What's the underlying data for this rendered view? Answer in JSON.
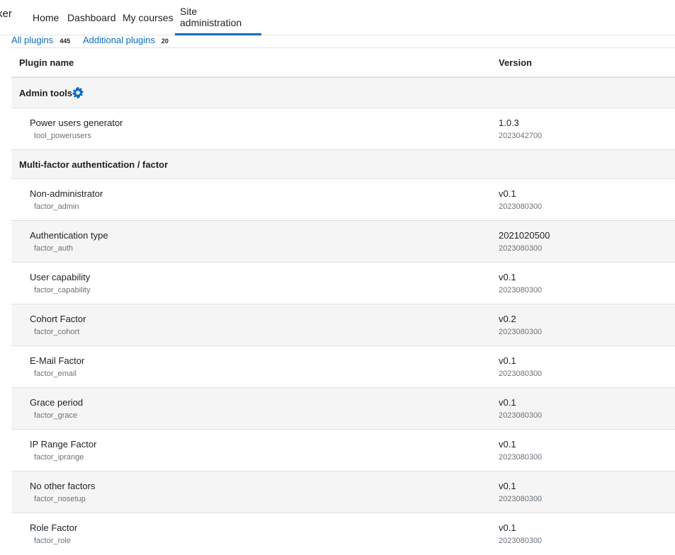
{
  "navbar": {
    "brand": "ker",
    "items": [
      {
        "label": "Home"
      },
      {
        "label": "Dashboard"
      },
      {
        "label": "My courses"
      },
      {
        "label": "Site administration"
      }
    ]
  },
  "tabs": [
    {
      "label": "All plugins",
      "count": "445"
    },
    {
      "label": "Additional plugins",
      "count": "20"
    }
  ],
  "table": {
    "headers": {
      "name": "Plugin name",
      "version": "Version"
    },
    "groups": [
      {
        "title": "Admin tools",
        "icon": "cog-icon",
        "plugins": [
          {
            "name": "Power users generator",
            "component": "tool_powerusers",
            "release": "1.0.3",
            "version": "2023042700"
          }
        ]
      },
      {
        "title": "Multi-factor authentication / factor",
        "plugins": [
          {
            "name": "Non-administrator",
            "component": "factor_admin",
            "release": "v0.1",
            "version": "2023080300"
          },
          {
            "name": "Authentication type",
            "component": "factor_auth",
            "release": "2021020500",
            "version": "2023080300"
          },
          {
            "name": "User capability",
            "component": "factor_capability",
            "release": "v0.1",
            "version": "2023080300"
          },
          {
            "name": "Cohort Factor",
            "component": "factor_cohort",
            "release": "v0.2",
            "version": "2023080300"
          },
          {
            "name": "E-Mail Factor",
            "component": "factor_email",
            "release": "v0.1",
            "version": "2023080300"
          },
          {
            "name": "Grace period",
            "component": "factor_grace",
            "release": "v0.1",
            "version": "2023080300"
          },
          {
            "name": "IP Range Factor",
            "component": "factor_iprange",
            "release": "v0.1",
            "version": "2023080300"
          },
          {
            "name": "No other factors",
            "component": "factor_nosetup",
            "release": "v0.1",
            "version": "2023080300"
          },
          {
            "name": "Role Factor",
            "component": "factor_role",
            "release": "v0.1",
            "version": "2023080300"
          }
        ]
      }
    ]
  },
  "colors": {
    "link": "#0f6cbf",
    "muted": "#6a737b",
    "stripe": "#f5f5f5"
  }
}
